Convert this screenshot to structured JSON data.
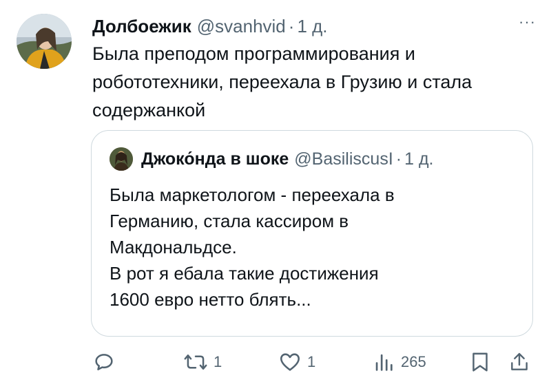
{
  "tweet": {
    "author_name": "Долбоежик",
    "author_handle": "@svanhvid",
    "separator": "·",
    "time": "1 д.",
    "more_label": "···",
    "text": "Была преподом программирования и\nробототехники, переехала в Грузию и стала\nсодержанкой"
  },
  "quote": {
    "author_name": "Джоко́нда в шоке",
    "author_handle": "@BasiliscusI",
    "separator": "·",
    "time": "1 д.",
    "text": "Была маркетологом - переехала в\nГерманию, стала кассиром в\nМакдональдсе.\nВ рот я ебала такие достижения\n1600 евро нетто блять..."
  },
  "actions": {
    "reply_icon": "reply-icon",
    "retweet_count": "1",
    "like_count": "1",
    "views_count": "265",
    "bookmark_icon": "bookmark-icon",
    "share_icon": "share-icon"
  },
  "colors": {
    "text": "#0f1419",
    "secondary": "#536471",
    "border": "#cfd9de"
  }
}
